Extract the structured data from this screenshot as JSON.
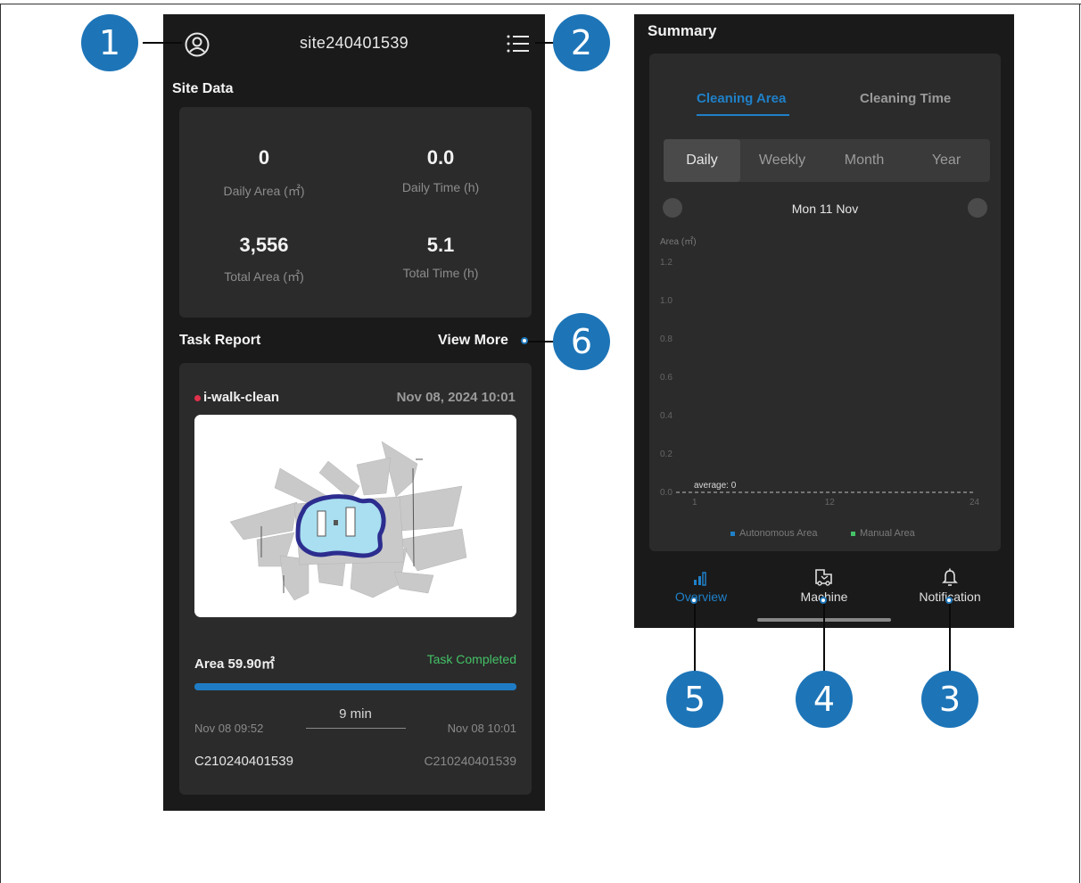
{
  "left_phone": {
    "site_name": "site240401539",
    "icons": {
      "profile": "user-circle-icon",
      "menu": "list-menu-icon"
    },
    "site_data": {
      "title": "Site Data",
      "daily_area_value": "0",
      "daily_area_label": "Daily Area (㎡)",
      "daily_time_value": "0.0",
      "daily_time_label": "Daily Time (h)",
      "total_area_value": "3,556",
      "total_area_label": "Total Area (㎡)",
      "total_time_value": "5.1",
      "total_time_label": "Total Time (h)"
    },
    "task_report": {
      "title": "Task Report",
      "view_more": "View More",
      "task_name": "i-walk-clean",
      "task_datetime": "Nov 08, 2024 10:01",
      "area": "Area 59.90㎡",
      "status": "Task Completed",
      "progress_pct": 100,
      "duration": "9 min",
      "start_time": "Nov 08 09:52",
      "end_time": "Nov 08 10:01",
      "machine_id_left": "C210240401539",
      "machine_id_right": "C210240401539"
    }
  },
  "right_phone": {
    "summary_title": "Summary",
    "tabs": [
      "Cleaning Area",
      "Cleaning Time"
    ],
    "active_tab": "Cleaning Area",
    "periods": [
      "Daily",
      "Weekly",
      "Month",
      "Year"
    ],
    "active_period": "Daily",
    "date_label": "Mon 11 Nov",
    "bottom_nav": [
      {
        "label": "Overview",
        "icon": "bar-chart-icon",
        "active": true
      },
      {
        "label": "Machine",
        "icon": "machine-icon",
        "active": false
      },
      {
        "label": "Notification",
        "icon": "bell-icon",
        "active": false
      }
    ]
  },
  "chart_data": {
    "type": "bar",
    "ylabel": "Area (㎡)",
    "yticks": [
      "1.2",
      "1.0",
      "0.8",
      "0.6",
      "0.4",
      "0.2",
      "0.0"
    ],
    "ylim": [
      0,
      1.2
    ],
    "xticks": [
      "1",
      "12",
      "24"
    ],
    "average_label": "average: 0",
    "series": [
      {
        "name": "Autonomous Area",
        "color": "#1f80c8",
        "values": []
      },
      {
        "name": "Manual Area",
        "color": "#44c267",
        "values": []
      }
    ]
  },
  "callouts": [
    "1",
    "2",
    "3",
    "4",
    "5",
    "6"
  ],
  "colors": {
    "accent": "#1f80c8",
    "callout": "#1d75b8",
    "success": "#44c267",
    "task_dot": "#e0314b"
  }
}
